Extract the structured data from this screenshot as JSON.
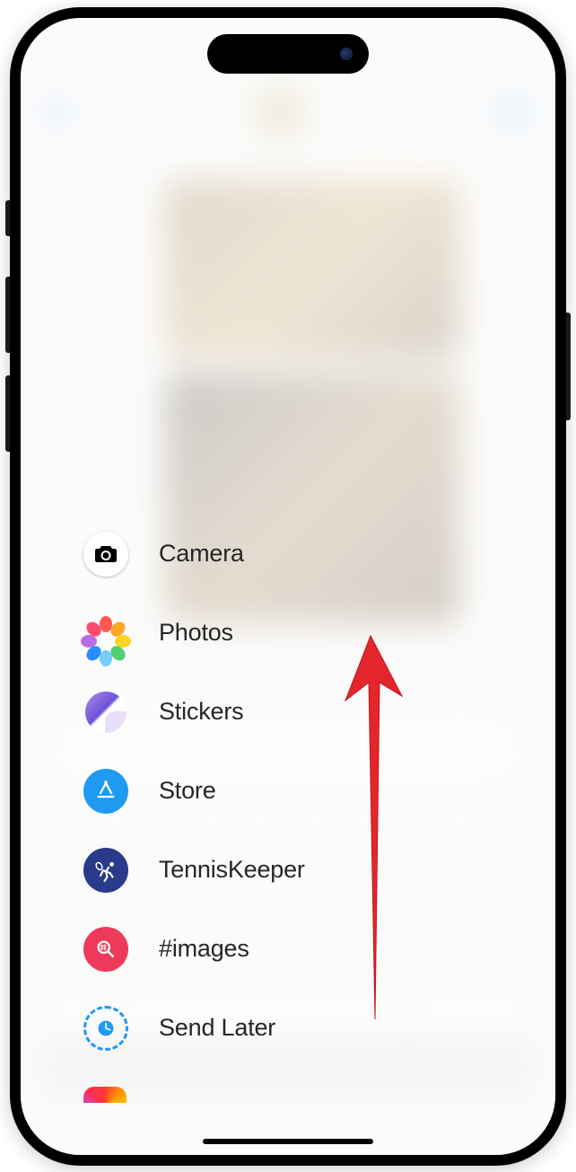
{
  "menu": {
    "items": [
      {
        "label": "Camera",
        "icon": "camera"
      },
      {
        "label": "Photos",
        "icon": "photos"
      },
      {
        "label": "Stickers",
        "icon": "stickers"
      },
      {
        "label": "Store",
        "icon": "store"
      },
      {
        "label": "TennisKeeper",
        "icon": "tenniskeeper"
      },
      {
        "label": "#images",
        "icon": "hash-images"
      },
      {
        "label": "Send Later",
        "icon": "send-later"
      }
    ]
  },
  "colors": {
    "store": "#1e9af1",
    "tennis": "#2a3a8a",
    "images": "#ee3a5a",
    "sendlater": "#1e9af1",
    "arrow": "#e4252b"
  },
  "annotation": {
    "type": "arrow",
    "direction": "up",
    "meaning": "scroll up gesture"
  }
}
